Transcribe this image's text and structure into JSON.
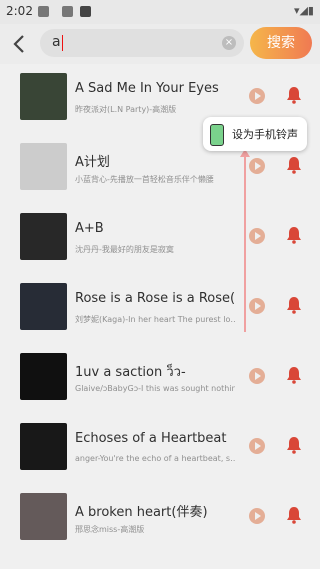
{
  "status_bar": {
    "time": "2:02"
  },
  "search": {
    "value": "a",
    "button_label": "搜索"
  },
  "songs": [
    {
      "title": "A Sad Me In Your Eyes",
      "subtitle": "昨夜派对(L.N Party)-高潮版",
      "cover_color": "#3d4a3a"
    },
    {
      "title": "A计划",
      "subtitle": "小蓝背心-先播放一首轻松音乐伴个懒腰",
      "cover_color": "#d9d9d9"
    },
    {
      "title": "A+B",
      "subtitle": "沈丹丹-我最好的朋友是寂寞",
      "cover_color": "#2b2b2b"
    },
    {
      "title": "Rose is a Rose is a Rose(…",
      "subtitle": "刘梦妮(Kaga)-In her heart The purest lo…",
      "cover_color": "#2a2f3a"
    },
    {
      "title": "1uv a saction ว็ว-",
      "subtitle": "Glaive/ↄBabyGↄ-I this was sought  nothing…",
      "cover_color": "#111111"
    },
    {
      "title": "Echoses of a Heartbeat",
      "subtitle": "anger-You're the echo of a heartbeat, s…",
      "cover_color": "#1a1a1a"
    },
    {
      "title": "A broken heart(伴奏)",
      "subtitle": "邢思念miss-高潮版",
      "cover_color": "#6b6060"
    }
  ],
  "tooltip": {
    "text": "设为手机铃声"
  },
  "colors": {
    "accent": "#f07a52",
    "bell": "#e74c3c"
  }
}
